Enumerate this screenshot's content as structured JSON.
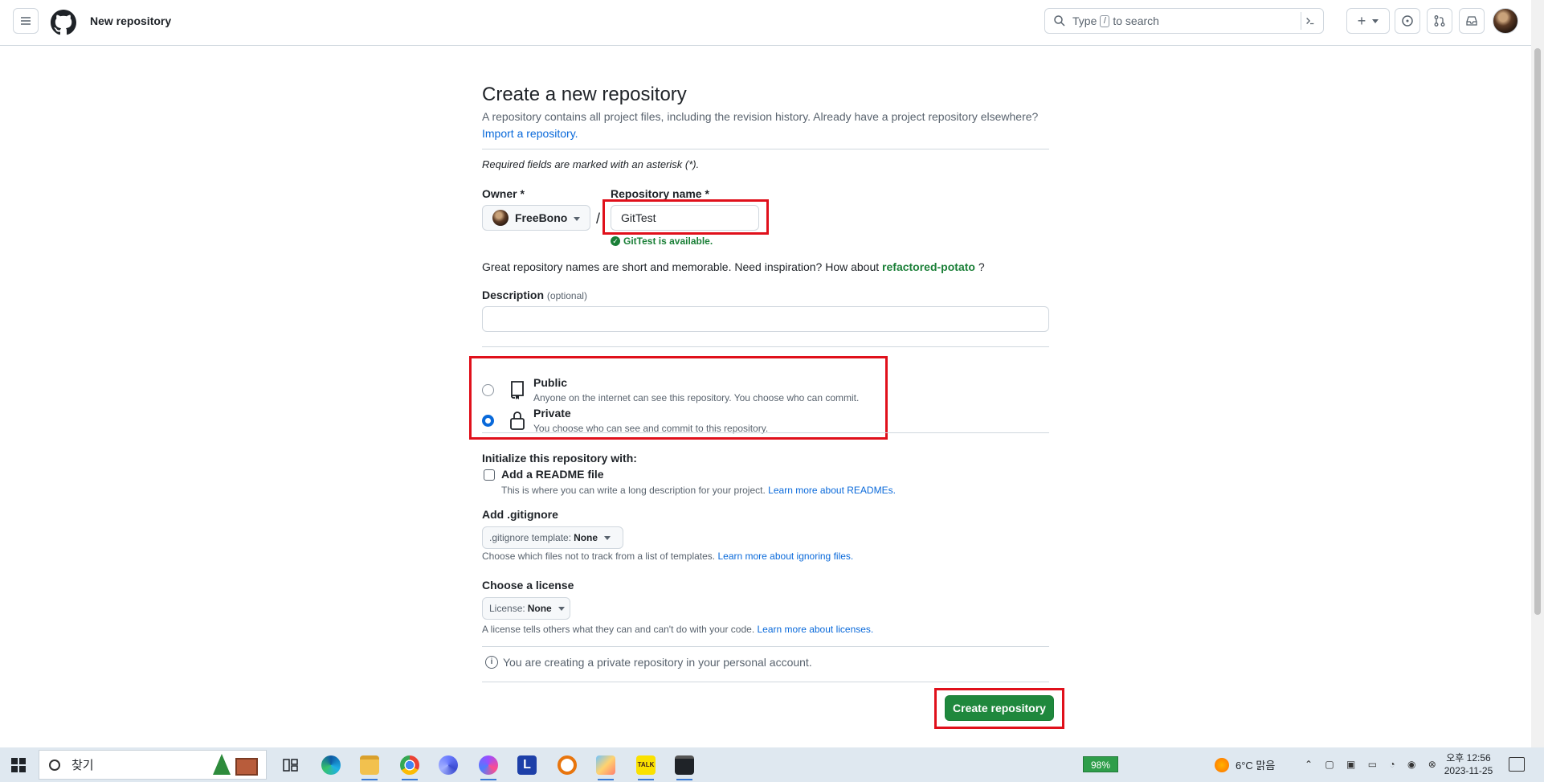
{
  "header": {
    "title": "New repository",
    "search_text_before": "Type",
    "search_key": "/",
    "search_text_after": "to search",
    "plus_label": "+"
  },
  "form": {
    "title": "Create a new repository",
    "subtitle": "A repository contains all project files, including the revision history. Already have a project repository elsewhere?",
    "import_link": "Import a repository.",
    "required_note": "Required fields are marked with an asterisk (*).",
    "owner_label": "Owner *",
    "owner_value": "FreeBono",
    "slash": "/",
    "repo_label": "Repository name *",
    "repo_value": "GitTest",
    "available_text": "GitTest is available.",
    "inspiration_text": "Great repository names are short and memorable. Need inspiration? How about",
    "inspiration_suggestion": "refactored-potato",
    "inspiration_end": "?",
    "description_label": "Description",
    "description_optional": "(optional)",
    "description_value": "",
    "visibility": [
      {
        "title": "Public",
        "desc": "Anyone on the internet can see this repository. You choose who can commit.",
        "selected": false
      },
      {
        "title": "Private",
        "desc": "You choose who can see and commit to this repository.",
        "selected": true
      }
    ],
    "init_label": "Initialize this repository with:",
    "readme_label": "Add a README file",
    "readme_desc": "This is where you can write a long description for your project.",
    "readme_link": "Learn more about READMEs.",
    "gitignore_label": "Add .gitignore",
    "gitignore_prefix": ".gitignore template:",
    "gitignore_value": "None",
    "gitignore_desc": "Choose which files not to track from a list of templates.",
    "gitignore_link": "Learn more about ignoring files.",
    "license_label": "Choose a license",
    "license_prefix": "License:",
    "license_value": "None",
    "license_desc": "A license tells others what they can and can't do with your code.",
    "license_link": "Learn more about licenses.",
    "notice": "You are creating a private repository in your personal account.",
    "submit_label": "Create repository"
  },
  "taskbar": {
    "search_placeholder": "찾기",
    "battery": "98%",
    "weather": "6°C  맑음",
    "time": "오후 12:56",
    "date": "2023-11-25"
  },
  "colors": {
    "primary_button": "#1f883d",
    "link": "#0969da",
    "success": "#1a7f37",
    "highlight_box": "#e0101b"
  }
}
